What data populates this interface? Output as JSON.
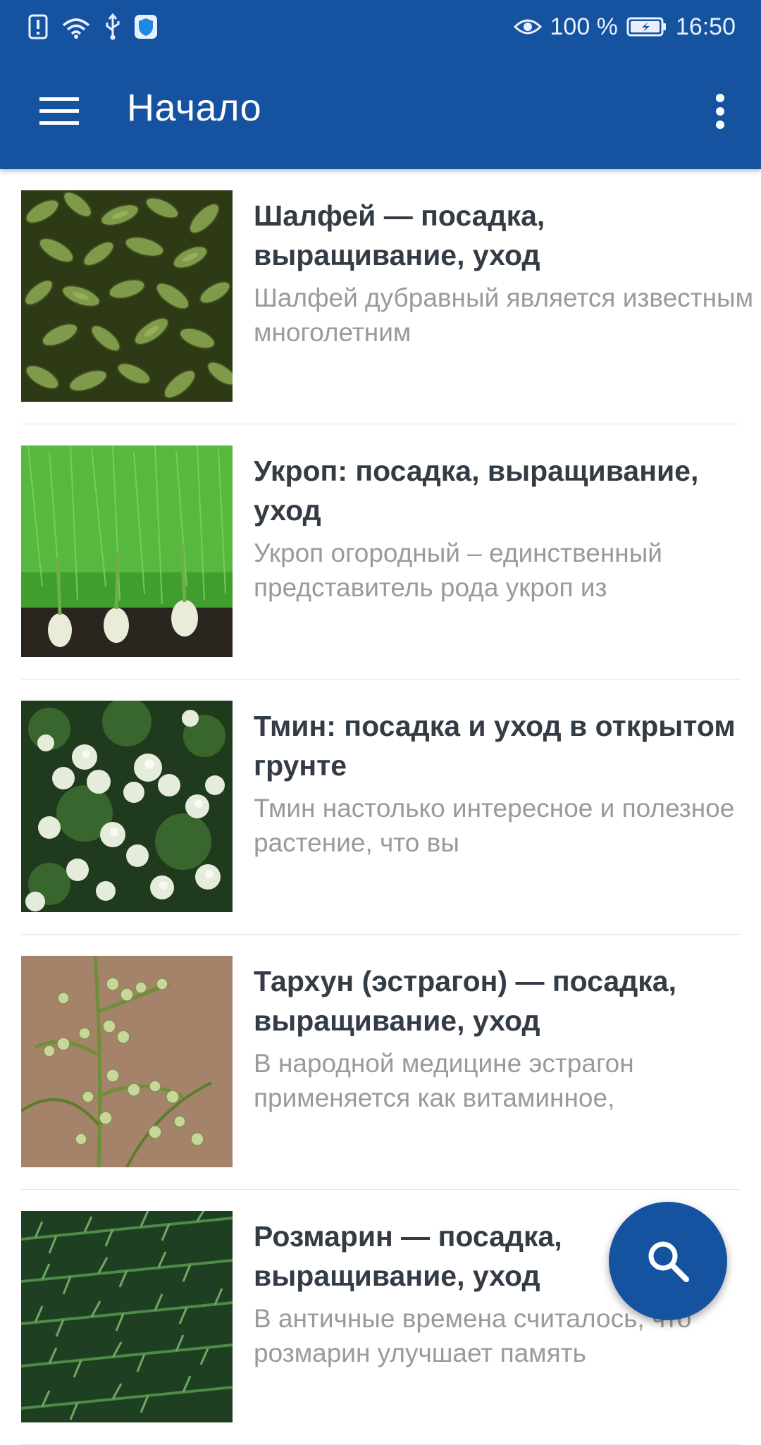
{
  "status_bar": {
    "battery_percent": "100 %",
    "time": "16:50",
    "icons": [
      "alert-icon",
      "wifi-icon",
      "usb-icon",
      "shield-icon",
      "eye-icon",
      "battery-icon"
    ]
  },
  "app_bar": {
    "title": "Начало",
    "menu_icon": "menu-icon",
    "overflow_icon": "more-vertical-icon"
  },
  "colors": {
    "primary": "#1553a0",
    "title_text": "#333b44",
    "excerpt_text": "#9a9a9a"
  },
  "articles": [
    {
      "title": "Шалфей — посадка, выращивание, уход",
      "excerpt": "Шалфей дубравный является известным многолетним",
      "image": "sage-seedlings-photo"
    },
    {
      "title": "Укроп: посадка, выращивание, уход",
      "excerpt": "Укроп огородный – единственный представитель рода укроп из",
      "image": "dill-fennel-photo"
    },
    {
      "title": "Тмин: посадка и уход в открытом грунте",
      "excerpt": "Тмин настолько интересное и полезное растение, что вы",
      "image": "caraway-flowers-photo"
    },
    {
      "title": "Тархун (эстрагон) — посадка, выращивание, уход",
      "excerpt": "В народной медицине эстрагон применяется как витаминное,",
      "image": "tarragon-plant-photo"
    },
    {
      "title": "Розмарин — посадка, выращивание, уход",
      "excerpt": "В античные времена считалось, что розмарин улучшает память",
      "image": "rosemary-photo"
    }
  ],
  "fab": {
    "icon": "search-icon"
  }
}
